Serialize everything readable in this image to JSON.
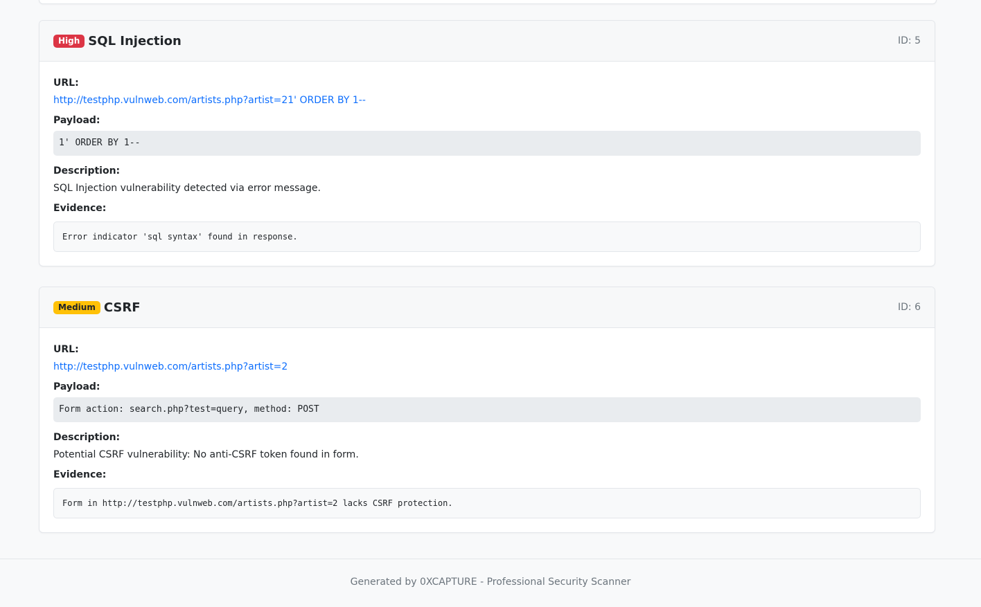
{
  "findings": [
    {
      "severity": "High",
      "title": "SQL Injection",
      "id_text": "ID: 5",
      "url_label": "URL:",
      "url": "http://testphp.vulnweb.com/artists.php?artist=21' ORDER BY 1--",
      "payload_label": "Payload:",
      "payload": "1' ORDER BY 1--",
      "description_label": "Description:",
      "description": "SQL Injection vulnerability detected via error message.",
      "evidence_label": "Evidence:",
      "evidence": "Error indicator 'sql syntax' found in response."
    },
    {
      "severity": "Medium",
      "title": "CSRF",
      "id_text": "ID: 6",
      "url_label": "URL:",
      "url": "http://testphp.vulnweb.com/artists.php?artist=2",
      "payload_label": "Payload:",
      "payload": "Form action: search.php?test=query, method: POST",
      "description_label": "Description:",
      "description": "Potential CSRF vulnerability: No anti-CSRF token found in form.",
      "evidence_label": "Evidence:",
      "evidence": "Form in http://testphp.vulnweb.com/artists.php?artist=2 lacks CSRF protection."
    }
  ],
  "footer": {
    "text": "Generated by 0XCAPTURE - Professional Security Scanner"
  },
  "colors": {
    "high": "#dc3545",
    "medium": "#ffc107",
    "link": "#0d6efd"
  }
}
